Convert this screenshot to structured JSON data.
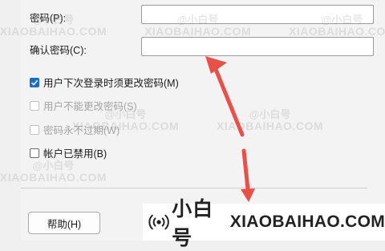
{
  "form": {
    "password_label": "密码(P):",
    "confirm_label": "确认密码(C):",
    "options": [
      {
        "label": "用户下次登录时须更改密码(M)",
        "checked": true,
        "enabled": true
      },
      {
        "label": "用户不能更改密码(S)",
        "checked": false,
        "enabled": false
      },
      {
        "label": "密码永不过期(W)",
        "checked": false,
        "enabled": false
      },
      {
        "label": "帐户已禁用(B)",
        "checked": false,
        "enabled": true
      }
    ],
    "help_button": "帮助(H)"
  },
  "watermark": {
    "main": "@小白号",
    "sub": "XIAOBAIHAO.COM"
  },
  "brand": {
    "name": "小白号",
    "domain": "XIAOBAIHAO.COM"
  },
  "colors": {
    "accent": "#1a6fc4",
    "arrow": "#e8504a"
  }
}
